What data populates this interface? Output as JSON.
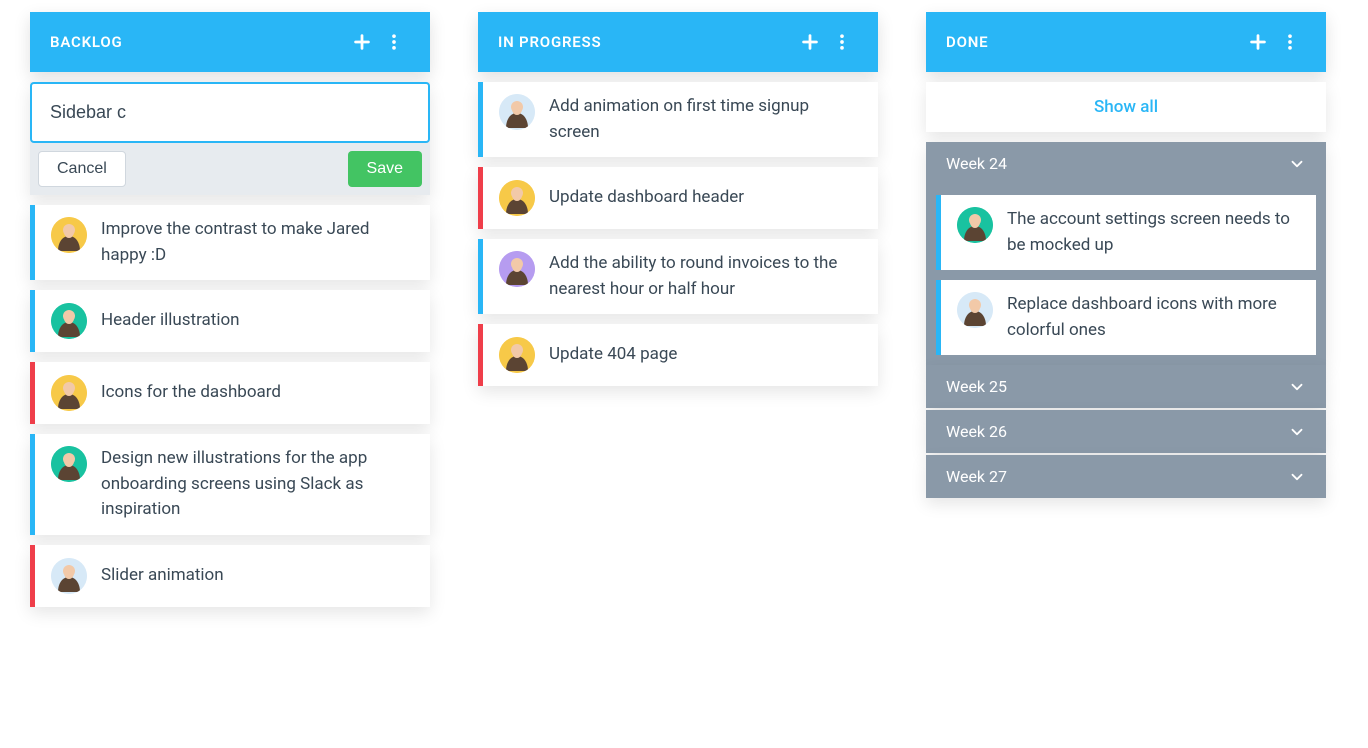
{
  "columns": {
    "backlog": {
      "title": "BACKLOG",
      "compose": {
        "value": "Sidebar c",
        "cancel_label": "Cancel",
        "save_label": "Save"
      },
      "cards": [
        {
          "text": "Improve the contrast to make Jared happy :D",
          "accent": "#29b6f6",
          "avatar_bg": "#f7c948"
        },
        {
          "text": "Header illustration",
          "accent": "#29b6f6",
          "avatar_bg": "#19c2a0"
        },
        {
          "text": "Icons for the dashboard",
          "accent": "#ef3e4a",
          "avatar_bg": "#f7c948"
        },
        {
          "text": "Design new illustrations for the app onboarding screens using Slack as inspiration",
          "accent": "#29b6f6",
          "avatar_bg": "#19c2a0"
        },
        {
          "text": "Slider animation",
          "accent": "#ef3e4a",
          "avatar_bg": "#d7e9f7"
        }
      ]
    },
    "in_progress": {
      "title": "IN PROGRESS",
      "cards": [
        {
          "text": "Add animation on first time signup screen",
          "accent": "#29b6f6",
          "avatar_bg": "#d7e9f7"
        },
        {
          "text": "Update dashboard header",
          "accent": "#ef3e4a",
          "avatar_bg": "#f7c948"
        },
        {
          "text": "Add the ability to round invoices to the nearest hour or half hour",
          "accent": "#29b6f6",
          "avatar_bg": "#b69cf0"
        },
        {
          "text": "Update 404 page",
          "accent": "#ef3e4a",
          "avatar_bg": "#f7c948"
        }
      ]
    },
    "done": {
      "title": "DONE",
      "show_all_label": "Show all",
      "groups": [
        {
          "title": "Week 24",
          "expanded": true,
          "cards": [
            {
              "text": "The account settings screen needs to be mocked up",
              "accent": "#29b6f6",
              "avatar_bg": "#19c2a0"
            },
            {
              "text": "Replace dashboard icons with more colorful ones",
              "accent": "#29b6f6",
              "avatar_bg": "#d7e9f7"
            }
          ]
        },
        {
          "title": "Week 25",
          "expanded": false,
          "cards": []
        },
        {
          "title": "Week 26",
          "expanded": false,
          "cards": []
        },
        {
          "title": "Week 27",
          "expanded": false,
          "cards": []
        }
      ]
    }
  }
}
